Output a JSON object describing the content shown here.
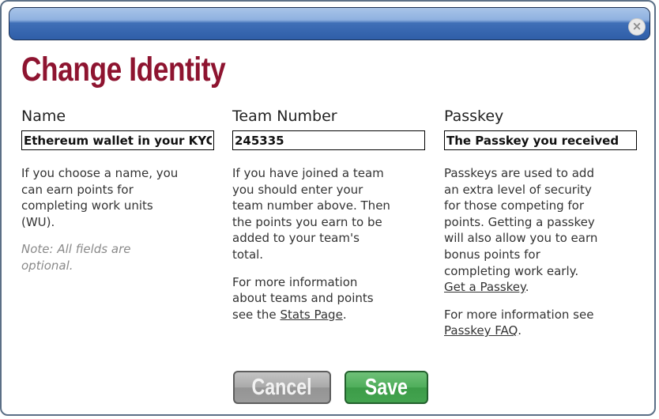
{
  "dialog": {
    "close_symbol": "×",
    "title": "Change Identity"
  },
  "name_col": {
    "label": "Name",
    "value": "Ethereum wallet in your KYC",
    "desc": "If you choose a name, you can earn points for completing work units (WU).",
    "note": "Note: All fields are optional."
  },
  "team_col": {
    "label": "Team Number",
    "value": "245335",
    "desc": "If you have joined a team you should enter your team number above. Then the points you earn to be added to your team's total.",
    "more_prefix": "For more information about teams and points see the ",
    "more_link": "Stats Page",
    "more_suffix": "."
  },
  "passkey_col": {
    "label": "Passkey",
    "value": "The Passkey you received",
    "desc": "Passkeys are used to add an extra level of security for those competing for points. Getting a passkey will also allow you to earn bonus points for completing work early.",
    "get_link": "Get a Passkey",
    "get_suffix": ".",
    "more_prefix": "For more information see ",
    "more_link": "Passkey FAQ",
    "more_suffix": "."
  },
  "buttons": {
    "cancel": "Cancel",
    "save": "Save"
  },
  "colors": {
    "title": "#8e1430",
    "titlebar": "#2f5ea8",
    "save": "#4fae5b",
    "cancel": "#a9a9a9"
  }
}
